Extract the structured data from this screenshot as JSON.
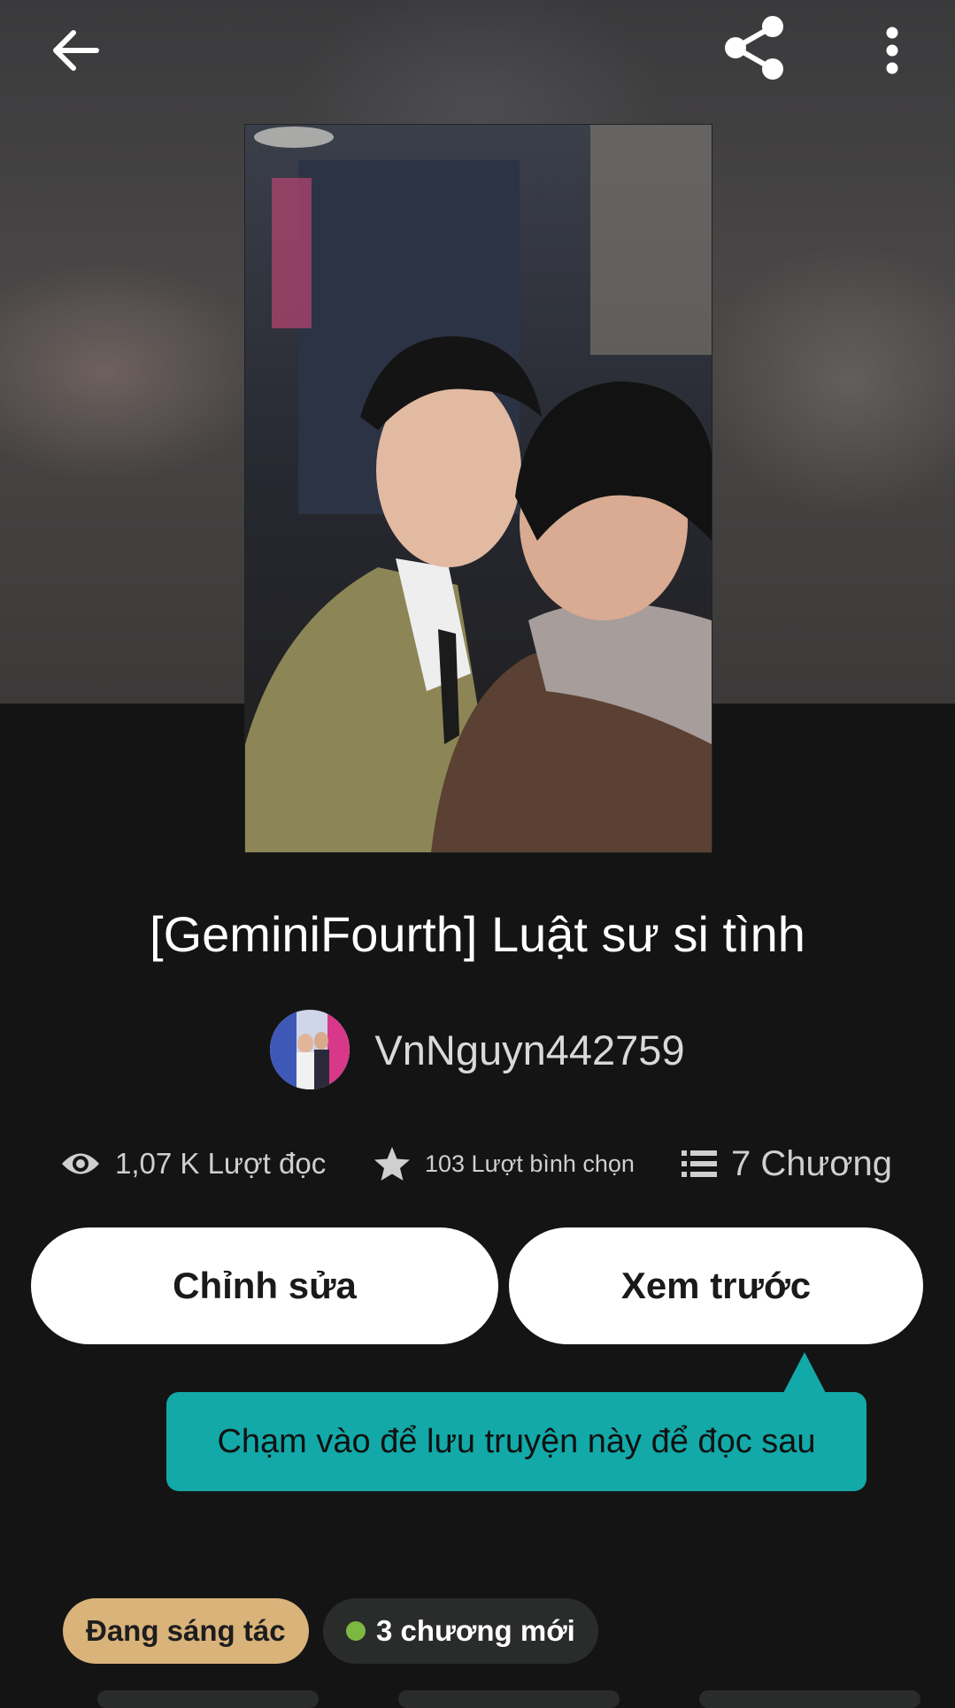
{
  "header": {
    "back_icon": "arrow-left-icon",
    "share_icon": "share-icon",
    "more_icon": "more-vertical-icon"
  },
  "story": {
    "title": "[GeminiFourth] Luật sư si tình",
    "author": "VnNguyn442759"
  },
  "stats": {
    "reads": "1,07 K Lượt đọc",
    "votes": "103 Lượt bình chọn",
    "chapters": "7 Chương"
  },
  "actions": {
    "edit_label": "Chỉnh sửa",
    "preview_label": "Xem trước"
  },
  "tooltip": {
    "text": "Chạm vào để lưu truyện này để đọc sau"
  },
  "tags": {
    "status": "Đang sáng tác",
    "new_chapters": "3 chương mới"
  },
  "colors": {
    "background": "#141414",
    "tooltip": "#12a9a8",
    "status_tag": "#d9b37a",
    "new_dot": "#7db843"
  }
}
